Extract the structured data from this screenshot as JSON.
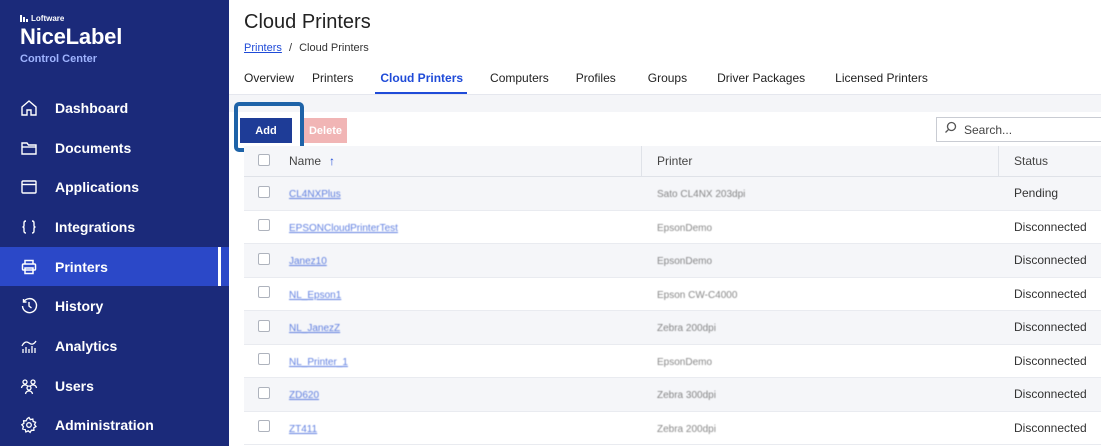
{
  "brand": {
    "small": "Loftware",
    "name": "NiceLabel",
    "sub": "Control Center"
  },
  "nav": [
    {
      "label": "Dashboard",
      "icon": "home-icon"
    },
    {
      "label": "Documents",
      "icon": "folder-icon"
    },
    {
      "label": "Applications",
      "icon": "window-icon"
    },
    {
      "label": "Integrations",
      "icon": "braces-icon"
    },
    {
      "label": "Printers",
      "icon": "printer-icon",
      "active": true
    },
    {
      "label": "History",
      "icon": "history-icon"
    },
    {
      "label": "Analytics",
      "icon": "analytics-icon"
    },
    {
      "label": "Users",
      "icon": "users-icon"
    },
    {
      "label": "Administration",
      "icon": "gear-icon"
    }
  ],
  "page": {
    "title": "Cloud Printers",
    "breadcrumb": {
      "parent": "Printers",
      "separator": "/",
      "current": "Cloud Printers"
    }
  },
  "tabs": [
    {
      "label": "Overview"
    },
    {
      "label": "Printers"
    },
    {
      "label": "Cloud Printers",
      "active": true
    },
    {
      "label": "Computers"
    },
    {
      "label": "Profiles"
    },
    {
      "label": "Groups"
    },
    {
      "label": "Driver Packages"
    },
    {
      "label": "Licensed Printers"
    }
  ],
  "toolbar": {
    "add_label": "Add",
    "delete_label": "Delete",
    "search_placeholder": "Search..."
  },
  "table": {
    "columns": {
      "name": "Name",
      "printer": "Printer",
      "status": "Status"
    },
    "sort_indicator": "↑",
    "rows": [
      {
        "name": "CL4NXPlus",
        "printer": "Sato CL4NX 203dpi",
        "status": "Pending"
      },
      {
        "name": "EPSONCloudPrinterTest",
        "printer": "EpsonDemo",
        "status": "Disconnected"
      },
      {
        "name": "Janez10",
        "printer": "EpsonDemo",
        "status": "Disconnected"
      },
      {
        "name": "NL_Epson1",
        "printer": "Epson CW-C4000",
        "status": "Disconnected"
      },
      {
        "name": "NL_JanezZ",
        "printer": "Zebra 200dpi",
        "status": "Disconnected"
      },
      {
        "name": "NL_Printer_1",
        "printer": "EpsonDemo",
        "status": "Disconnected"
      },
      {
        "name": "ZD620",
        "printer": "Zebra 300dpi",
        "status": "Disconnected"
      },
      {
        "name": "ZT411",
        "printer": "Zebra 200dpi",
        "status": "Disconnected"
      }
    ]
  },
  "colors": {
    "sidebar": "#1b2a7a",
    "active_nav": "#2b48c8",
    "accent": "#1f4bd8",
    "add_button": "#1e3c97",
    "delete_button": "#f1b5b5"
  }
}
